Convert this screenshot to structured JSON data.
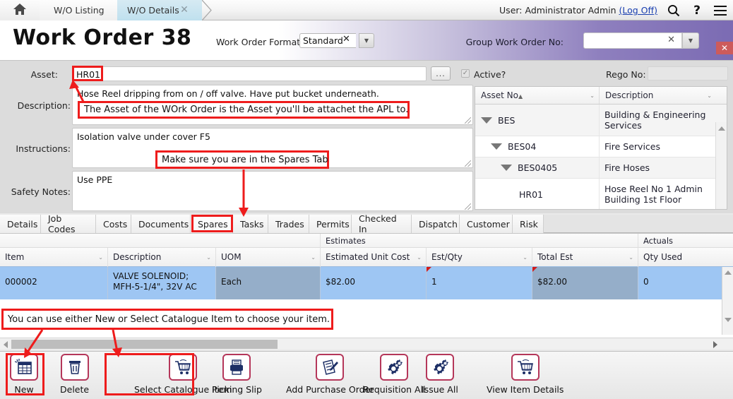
{
  "breadcrumb": {
    "home_icon": "home-icon",
    "items": [
      {
        "label": "W/O Listing",
        "active": false
      },
      {
        "label": "W/O Details",
        "active": true,
        "close": "✕"
      }
    ]
  },
  "topbar": {
    "user_prefix": "User: Administrator Admin ",
    "logoff_label": "(Log Off)",
    "search_icon": "🔍",
    "help_icon": "?",
    "menu_icon": "☰"
  },
  "title_band": {
    "title": "Work Order 38",
    "format_label": "Work Order Format",
    "format_value": "Standard",
    "format_clear": "✕",
    "format_caret": "▼",
    "group_wo_label": "Group Work Order No:",
    "group_wo_value": "",
    "group_wo_clear": "✕",
    "group_wo_caret": "▼",
    "window_close": "✕",
    "accent_purple": "#7b6bb3",
    "close_red": "#cd5b5b"
  },
  "form": {
    "asset_label": "Asset:",
    "asset_value": "HR01",
    "browse_button": "...",
    "active_label": "Active?",
    "active_checked": true,
    "active_check_glyph": "✓",
    "rego_label": "Rego No:",
    "rego_value": "",
    "description_label": "Description:",
    "description_value": "Hose Reel dripping from on / off valve. Have put bucket underneath.",
    "instructions_label": "Instructions:",
    "instructions_value": "Isolation valve under cover F5",
    "safety_label": "Safety Notes:",
    "safety_value": "Use PPE"
  },
  "asset_tree": {
    "columns": [
      {
        "label": "Asset No",
        "sort": "▲",
        "caret": "⌄"
      },
      {
        "label": "Description",
        "caret": "⌄"
      }
    ],
    "rows": [
      {
        "no": "BES",
        "desc": "Building & Engineering Services",
        "indent": 0,
        "expander": true
      },
      {
        "no": "BES04",
        "desc": "Fire Services",
        "indent": 1,
        "expander": true
      },
      {
        "no": "BES0405",
        "desc": "Fire Hoses",
        "indent": 2,
        "expander": true
      },
      {
        "no": "HR01",
        "desc": "Hose Reel No 1 Admin Building 1st Floor",
        "indent": 3,
        "expander": false
      }
    ]
  },
  "tabs": [
    {
      "label": "Details",
      "active": false
    },
    {
      "label": "Job Codes",
      "active": false
    },
    {
      "label": "Costs",
      "active": false
    },
    {
      "label": "Documents",
      "active": false
    },
    {
      "label": "Spares",
      "active": true
    },
    {
      "label": "Tasks",
      "active": false
    },
    {
      "label": "Trades",
      "active": false
    },
    {
      "label": "Permits",
      "active": false
    },
    {
      "label": "Checked In",
      "active": false
    },
    {
      "label": "Dispatch",
      "active": false
    },
    {
      "label": "Customer",
      "active": false
    },
    {
      "label": "Risk",
      "active": false
    }
  ],
  "grid": {
    "group_headers": [
      {
        "label": "Estimates"
      },
      {
        "label": "Actuals"
      }
    ],
    "columns": [
      {
        "label": "Item",
        "caret": "⌄"
      },
      {
        "label": "Description",
        "caret": "⌄"
      },
      {
        "label": "UOM",
        "caret": "⌄"
      },
      {
        "label": "Estimated Unit Cost",
        "caret": "⌄"
      },
      {
        "label": "Est/Qty",
        "caret": "⌄"
      },
      {
        "label": "Total Est",
        "caret": "⌄"
      },
      {
        "label": "Qty Used",
        "caret": ""
      }
    ],
    "rows": [
      {
        "item": "000002",
        "description": "VALVE SOLENOID; MFH-5-1/4\", 32V AC",
        "uom": "Each",
        "estimated_unit_cost": "$82.00",
        "est_qty": "1",
        "total_est": "$82.00",
        "qty_used": "0",
        "selected": true
      }
    ]
  },
  "toolbar": {
    "buttons": [
      {
        "label": "New",
        "icon": "new-record-icon"
      },
      {
        "label": "Delete",
        "icon": "trash-icon"
      },
      {
        "label": "Select Catalogue Item",
        "icon": "shopping-cart-icon"
      },
      {
        "label": "Picking Slip",
        "icon": "printer-icon"
      },
      {
        "label": "Add Purchase Order",
        "icon": "document-pen-icon"
      },
      {
        "label": "Requisition All",
        "icon": "gears-icon"
      },
      {
        "label": "Issue All",
        "icon": "gears-icon"
      },
      {
        "label": "View Item Details",
        "icon": "shopping-cart-icon"
      }
    ]
  },
  "annotations": {
    "asset_note": "The Asset of the WOrk Order is the Asset you'll be attachet the APL to.",
    "spares_note": "Make sure you are in the Spares Tab",
    "toolbar_note": "You can use either New or Select Catalogue Item to choose your item.",
    "color": "#ee1c1c"
  }
}
